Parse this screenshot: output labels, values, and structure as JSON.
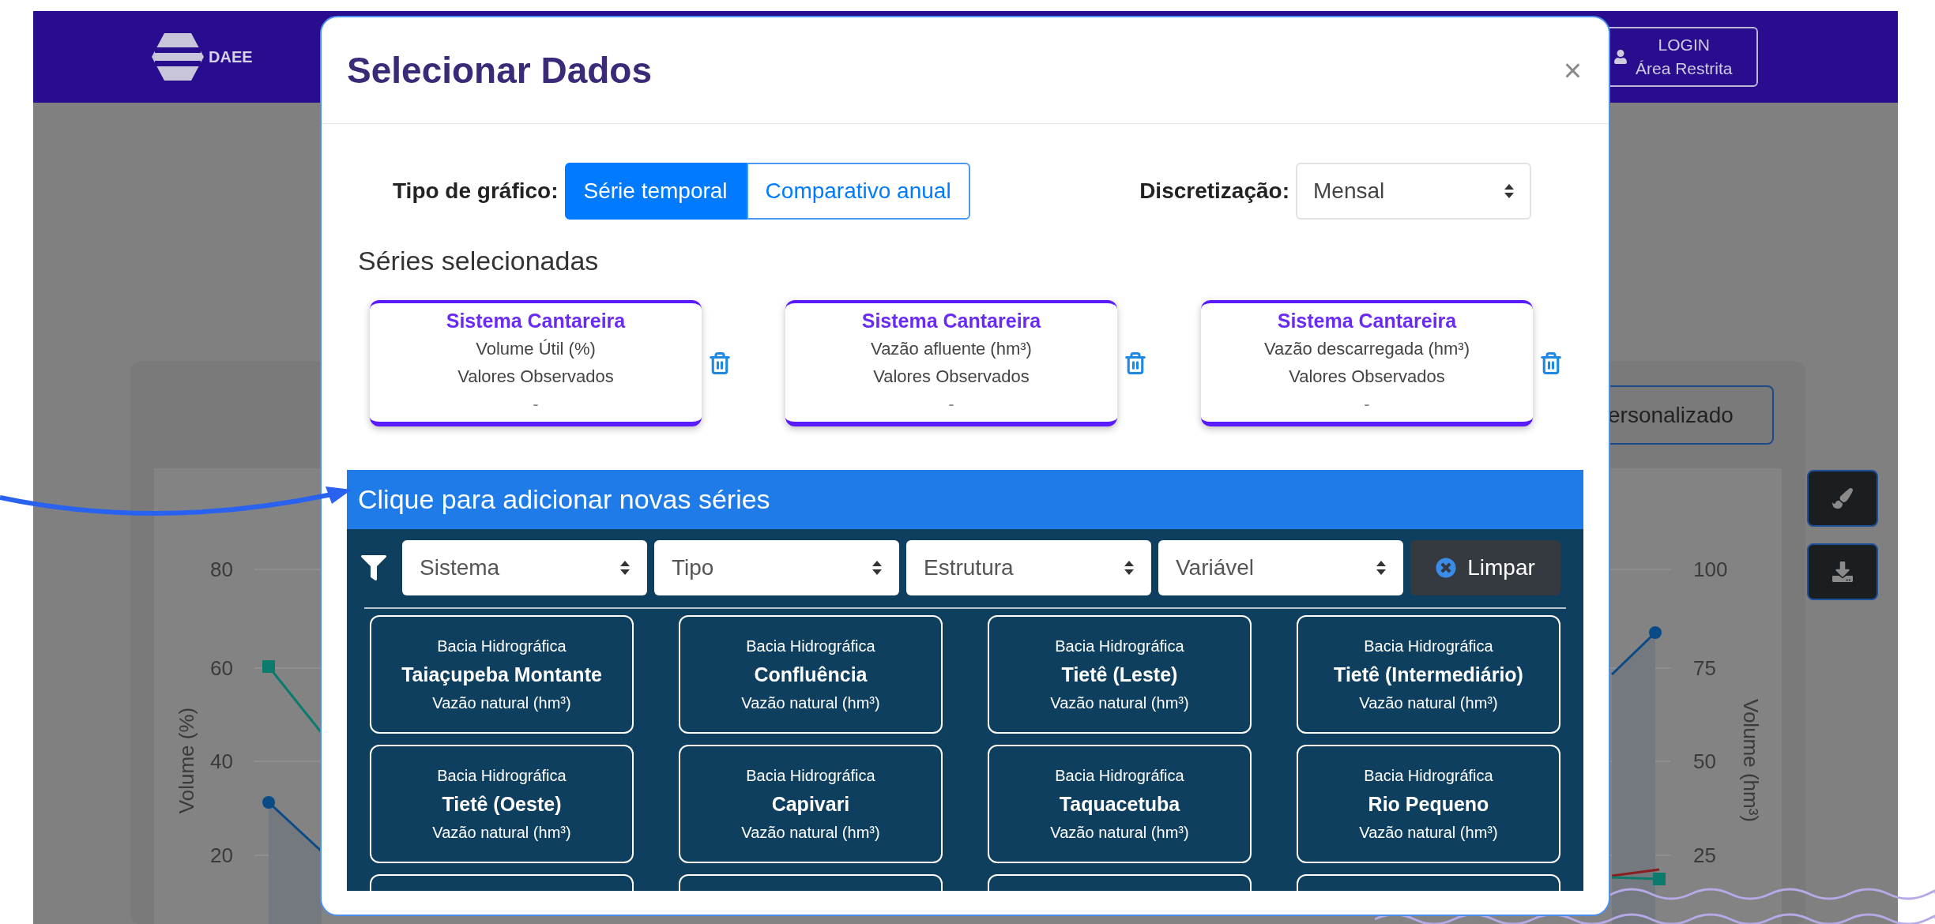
{
  "header": {
    "logo_text": "DAEE",
    "login_button": {
      "lines": [
        "LOGIN",
        "Área Restrita"
      ]
    }
  },
  "background": {
    "view_tab": "ersonalizado",
    "chart": {
      "left_axis_title": "Volume (%)",
      "left_ticks": [
        "80",
        "60",
        "40",
        "20"
      ],
      "right_axis_title": "Volume (hm³)",
      "right_ticks": [
        "100",
        "75",
        "50",
        "25"
      ]
    }
  },
  "modal": {
    "title": "Selecionar Dados",
    "close": "×",
    "chart_type": {
      "label": "Tipo de gráfico:",
      "options": [
        {
          "label": "Série temporal",
          "selected": true
        },
        {
          "label": "Comparativo anual",
          "selected": false
        }
      ]
    },
    "discretization": {
      "label": "Discretização:",
      "value": "Mensal"
    },
    "selected_heading": "Séries selecionadas",
    "selected_series": [
      {
        "system": "Sistema Cantareira",
        "variable": "Volume Útil (%)",
        "source": "Valores Observados",
        "period": "-"
      },
      {
        "system": "Sistema Cantareira",
        "variable": "Vazão afluente (hm³)",
        "source": "Valores Observados",
        "period": "-"
      },
      {
        "system": "Sistema Cantareira",
        "variable": "Vazão descarregada (hm³)",
        "source": "Valores Observados",
        "period": "-"
      }
    ],
    "add_bar": "Clique para adicionar novas séries",
    "filters": [
      {
        "value": "Sistema"
      },
      {
        "value": "Tipo"
      },
      {
        "value": "Estrutura"
      },
      {
        "value": "Variável"
      }
    ],
    "clear_button": "Limpar",
    "options": [
      {
        "category": "Bacia Hidrográfica",
        "name": "Taiaçupeba Montante",
        "variable": "Vazão natural (hm³)"
      },
      {
        "category": "Bacia Hidrográfica",
        "name": "Confluência",
        "variable": "Vazão natural (hm³)"
      },
      {
        "category": "Bacia Hidrográfica",
        "name": "Tietê (Leste)",
        "variable": "Vazão natural (hm³)"
      },
      {
        "category": "Bacia Hidrográfica",
        "name": "Tietê (Intermediário)",
        "variable": "Vazão natural (hm³)"
      },
      {
        "category": "Bacia Hidrográfica",
        "name": "Tietê (Oeste)",
        "variable": "Vazão natural (hm³)"
      },
      {
        "category": "Bacia Hidrográfica",
        "name": "Capivari",
        "variable": "Vazão natural (hm³)"
      },
      {
        "category": "Bacia Hidrográfica",
        "name": "Taquacetuba",
        "variable": "Vazão natural (hm³)"
      },
      {
        "category": "Bacia Hidrográfica",
        "name": "Rio Pequeno",
        "variable": "Vazão natural (hm³)"
      }
    ]
  }
}
